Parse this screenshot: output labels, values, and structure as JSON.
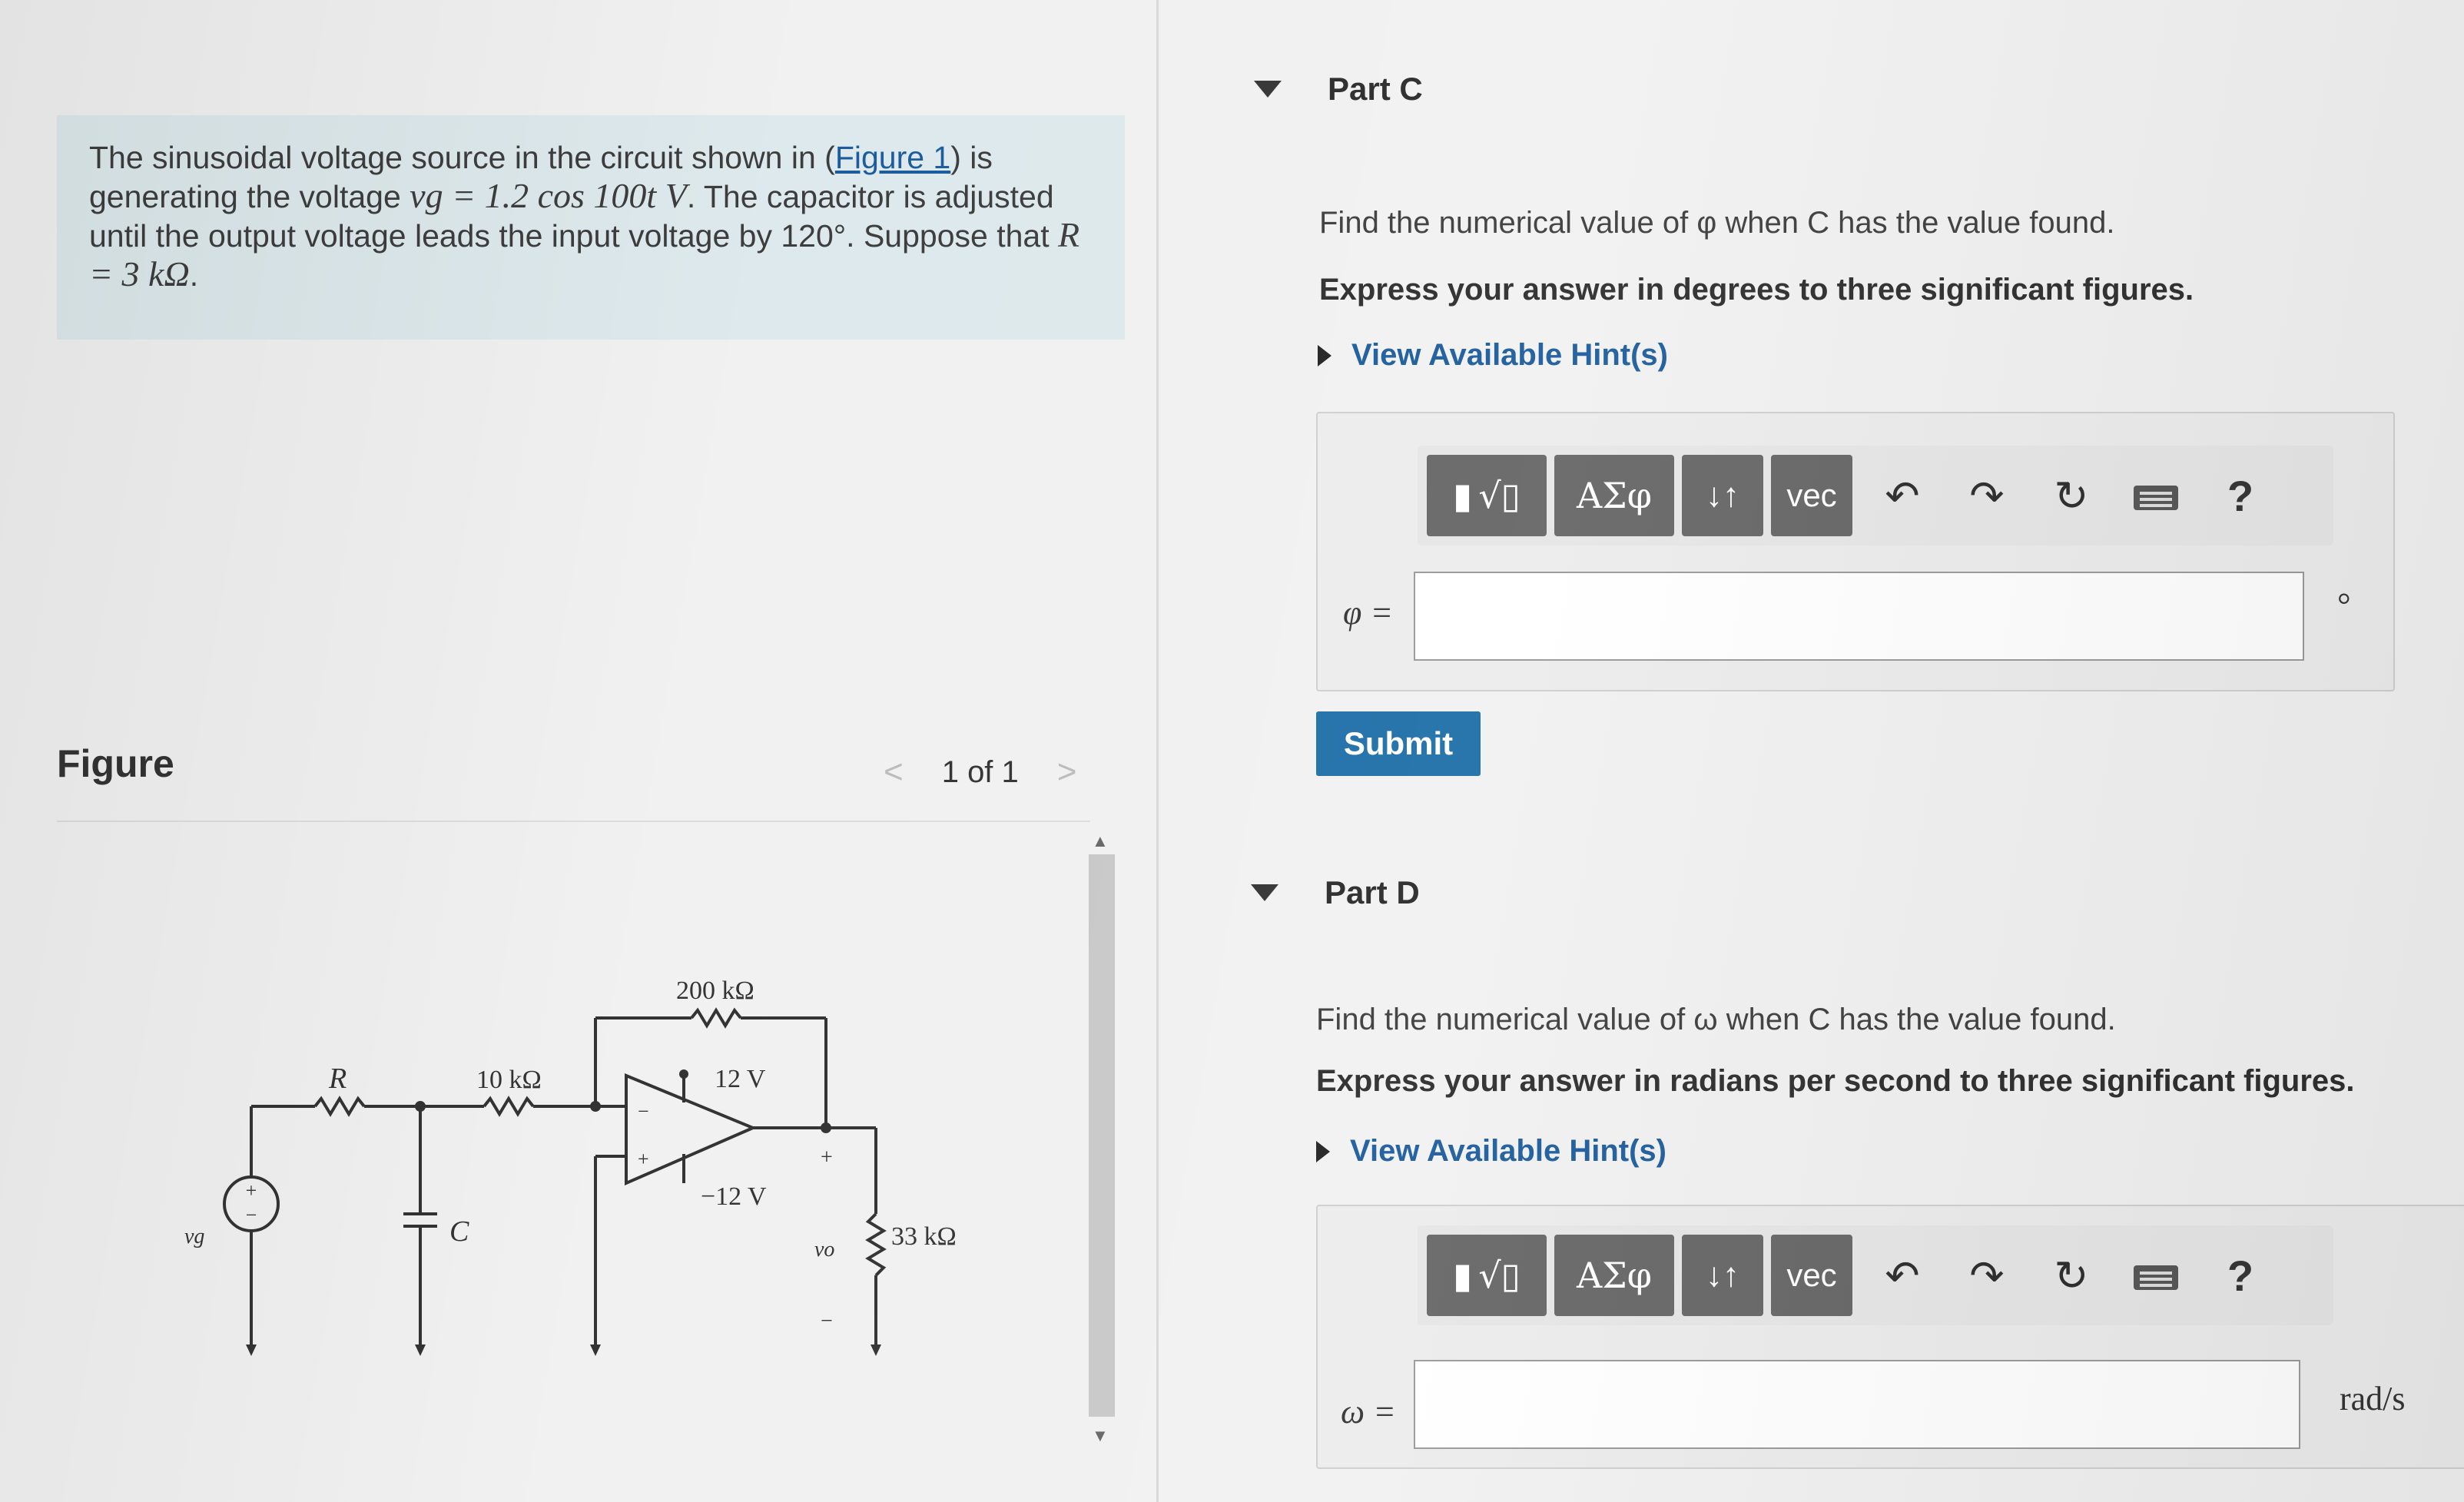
{
  "problem": {
    "text_1": "The sinusoidal voltage source in the circuit shown in (",
    "figure_link": "Figure 1",
    "text_2": ") is generating the voltage ",
    "vg_expr": "vg = 1.2 cos 100t V",
    "text_3": ". The capacitor is adjusted until the output voltage leads the input voltage by 120°. Suppose that ",
    "r_expr": "R = 3 kΩ",
    "text_4": "."
  },
  "figure": {
    "title": "Figure",
    "pager": "1 of 1",
    "prev_icon": "chevron-left",
    "next_icon": "chevron-right",
    "circuit": {
      "r_label": "R",
      "c_label": "C",
      "r10_label": "10 kΩ",
      "r200_label": "200 kΩ",
      "vpos_label": "12 V",
      "vneg_label": "−12 V",
      "r33_label": "33 kΩ",
      "vg_label": "vg",
      "vo_label": "vo",
      "plus": "+",
      "minus": "−"
    }
  },
  "partC": {
    "title": "Part C",
    "question": "Find the numerical value of φ when C has the value found.",
    "instruction": "Express your answer in degrees to three significant figures.",
    "hint": "View Available Hint(s)",
    "var_label": "φ =",
    "unit": "°",
    "submit": "Submit"
  },
  "partD": {
    "title": "Part D",
    "question": "Find the numerical value of ω when C has the value found.",
    "instruction": "Express your answer in radians per second to three significant figures.",
    "hint": "View Available Hint(s)",
    "var_label": "ω =",
    "unit": "rad/s"
  },
  "toolbar": {
    "greek": "ΑΣφ",
    "arrows": "↓↑",
    "vec": "vec",
    "undo_icon": "↶",
    "redo_icon": "↷",
    "reset_icon": "↻",
    "help": "?"
  }
}
